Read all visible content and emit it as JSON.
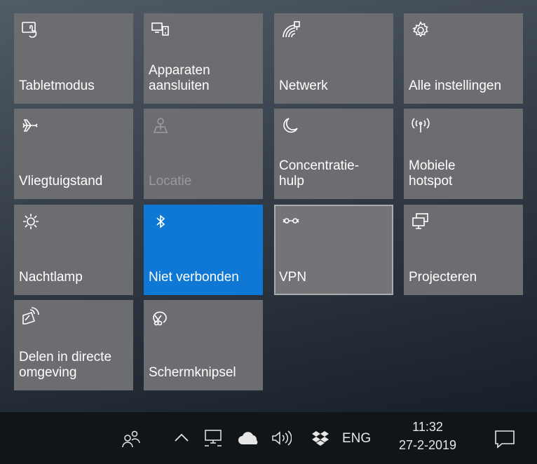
{
  "tiles": [
    {
      "label": "Tabletmodus",
      "icon": "tablet-mode-icon"
    },
    {
      "label": "Apparaten\naansluiten",
      "icon": "connect-devices-icon"
    },
    {
      "label": "Netwerk",
      "icon": "network-icon"
    },
    {
      "label": "Alle instellingen",
      "icon": "settings-gear-icon"
    },
    {
      "label": "Vliegtuigstand",
      "icon": "airplane-icon"
    },
    {
      "label": "Locatie",
      "icon": "location-icon"
    },
    {
      "label": "Concentratie-\nhulp",
      "icon": "moon-icon"
    },
    {
      "label": "Mobiele\nhotspot",
      "icon": "hotspot-icon"
    },
    {
      "label": "Nachtlamp",
      "icon": "brightness-sun-icon"
    },
    {
      "label": "Niet verbonden",
      "icon": "bluetooth-icon"
    },
    {
      "label": "VPN",
      "icon": "vpn-icon"
    },
    {
      "label": "Projecteren",
      "icon": "project-display-icon"
    },
    {
      "label": "Delen in directe\nomgeving",
      "icon": "nearby-share-icon"
    },
    {
      "label": "Schermknipsel",
      "icon": "screen-snip-icon"
    }
  ],
  "taskbar": {
    "language": "ENG",
    "time": "11:32",
    "date": "27-2-2019",
    "icons": [
      "people-icon",
      "show-hidden-chevron-icon",
      "network-wired-icon",
      "onedrive-cloud-icon",
      "volume-icon",
      "dropbox-icon",
      "action-center-icon"
    ]
  },
  "colors": {
    "tile": "#6b6d70",
    "tile_active": "#0f78d4",
    "taskbar": "#121518"
  }
}
